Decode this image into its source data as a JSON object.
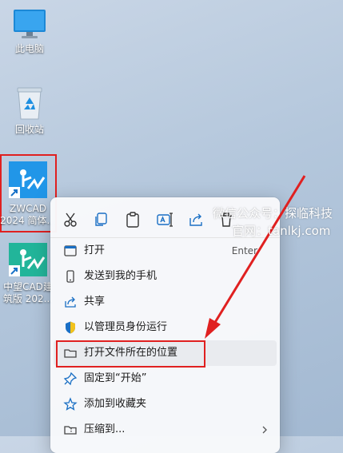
{
  "desktop": {
    "icons": [
      {
        "label": "此电脑"
      },
      {
        "label": "回收站"
      },
      {
        "label_line1": "ZWCAD",
        "label_line2": "2024 简体..."
      },
      {
        "label_line1": "中望CAD建",
        "label_line2": "筑版 202..."
      }
    ]
  },
  "context_menu": {
    "quick_actions": [
      "cut-icon",
      "copy-icon",
      "paste-icon",
      "rename-icon",
      "share-icon",
      "delete-icon"
    ],
    "items": [
      {
        "label": "打开",
        "shortcut": "Enter",
        "icon": "app-icon"
      },
      {
        "label": "发送到我的手机",
        "icon": "phone-icon"
      },
      {
        "label": "共享",
        "icon": "share-icon"
      },
      {
        "label": "以管理员身份运行",
        "icon": "shield-icon"
      },
      {
        "label": "打开文件所在的位置",
        "icon": "folder-icon"
      },
      {
        "label": "固定到“开始”",
        "icon": "pin-icon"
      },
      {
        "label": "添加到收藏夹",
        "icon": "star-icon"
      },
      {
        "label": "压缩到...",
        "icon": "zip-icon"
      }
    ]
  },
  "watermark": {
    "line1": "微信公众号：探临科技",
    "line2": "官网：tanlkj.com"
  },
  "colors": {
    "highlight": "#e02020",
    "accent": "#0067c0"
  }
}
